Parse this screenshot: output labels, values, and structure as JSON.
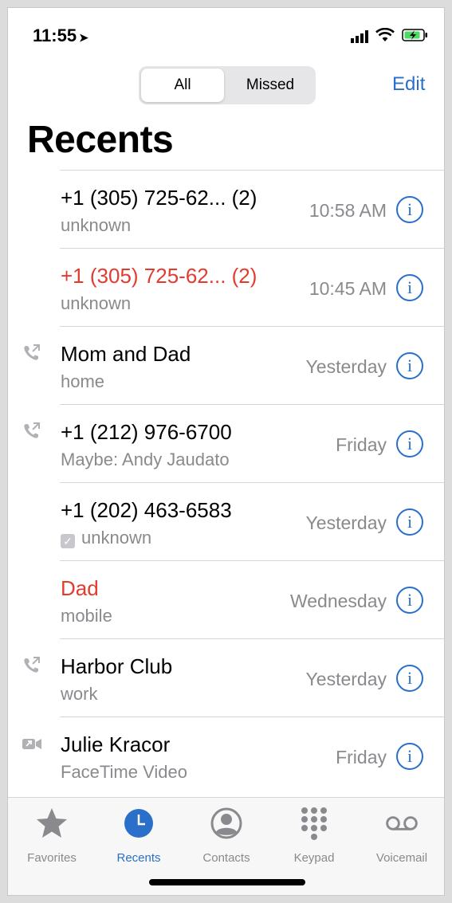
{
  "status": {
    "time": "11:55",
    "location_icon": "location-arrow-icon",
    "battery_state": "charging"
  },
  "segmented": {
    "all": "All",
    "missed": "Missed",
    "selected": "All"
  },
  "edit": "Edit",
  "title": "Recents",
  "calls": [
    {
      "name": "+1 (305) 725-62...  (2)",
      "detail": "unknown",
      "time": "10:58 AM",
      "missed": false,
      "icon": ""
    },
    {
      "name": "+1 (305) 725-62...  (2)",
      "detail": "unknown",
      "time": "10:45 AM",
      "missed": true,
      "icon": ""
    },
    {
      "name": "Mom and Dad",
      "detail": "home",
      "time": "Yesterday",
      "missed": false,
      "icon": "outgoing-call-icon"
    },
    {
      "name": "+1 (212) 976-6700",
      "detail": "Maybe: Andy Jaudato",
      "time": "Friday",
      "missed": false,
      "icon": "outgoing-call-icon"
    },
    {
      "name": "+1 (202) 463-6583",
      "detail": "unknown",
      "time": "Yesterday",
      "missed": false,
      "icon": "",
      "checkbox": true
    },
    {
      "name": "Dad",
      "detail": "mobile",
      "time": "Wednesday",
      "missed": true,
      "icon": ""
    },
    {
      "name": "Harbor Club",
      "detail": "work",
      "time": "Yesterday",
      "missed": false,
      "icon": "outgoing-call-icon"
    },
    {
      "name": "Julie Kracor",
      "detail": "FaceTime Video",
      "time": "Friday",
      "missed": false,
      "icon": "facetime-video-icon"
    }
  ],
  "tabs": [
    {
      "label": "Favorites",
      "icon": "star-icon",
      "active": false
    },
    {
      "label": "Recents",
      "icon": "clock-icon",
      "active": true
    },
    {
      "label": "Contacts",
      "icon": "person-circle-icon",
      "active": false
    },
    {
      "label": "Keypad",
      "icon": "keypad-icon",
      "active": false
    },
    {
      "label": "Voicemail",
      "icon": "voicemail-icon",
      "active": false
    }
  ],
  "colors": {
    "accent": "#2a6fc9",
    "missed": "#e23b30",
    "secondary": "#8a8a8e"
  }
}
